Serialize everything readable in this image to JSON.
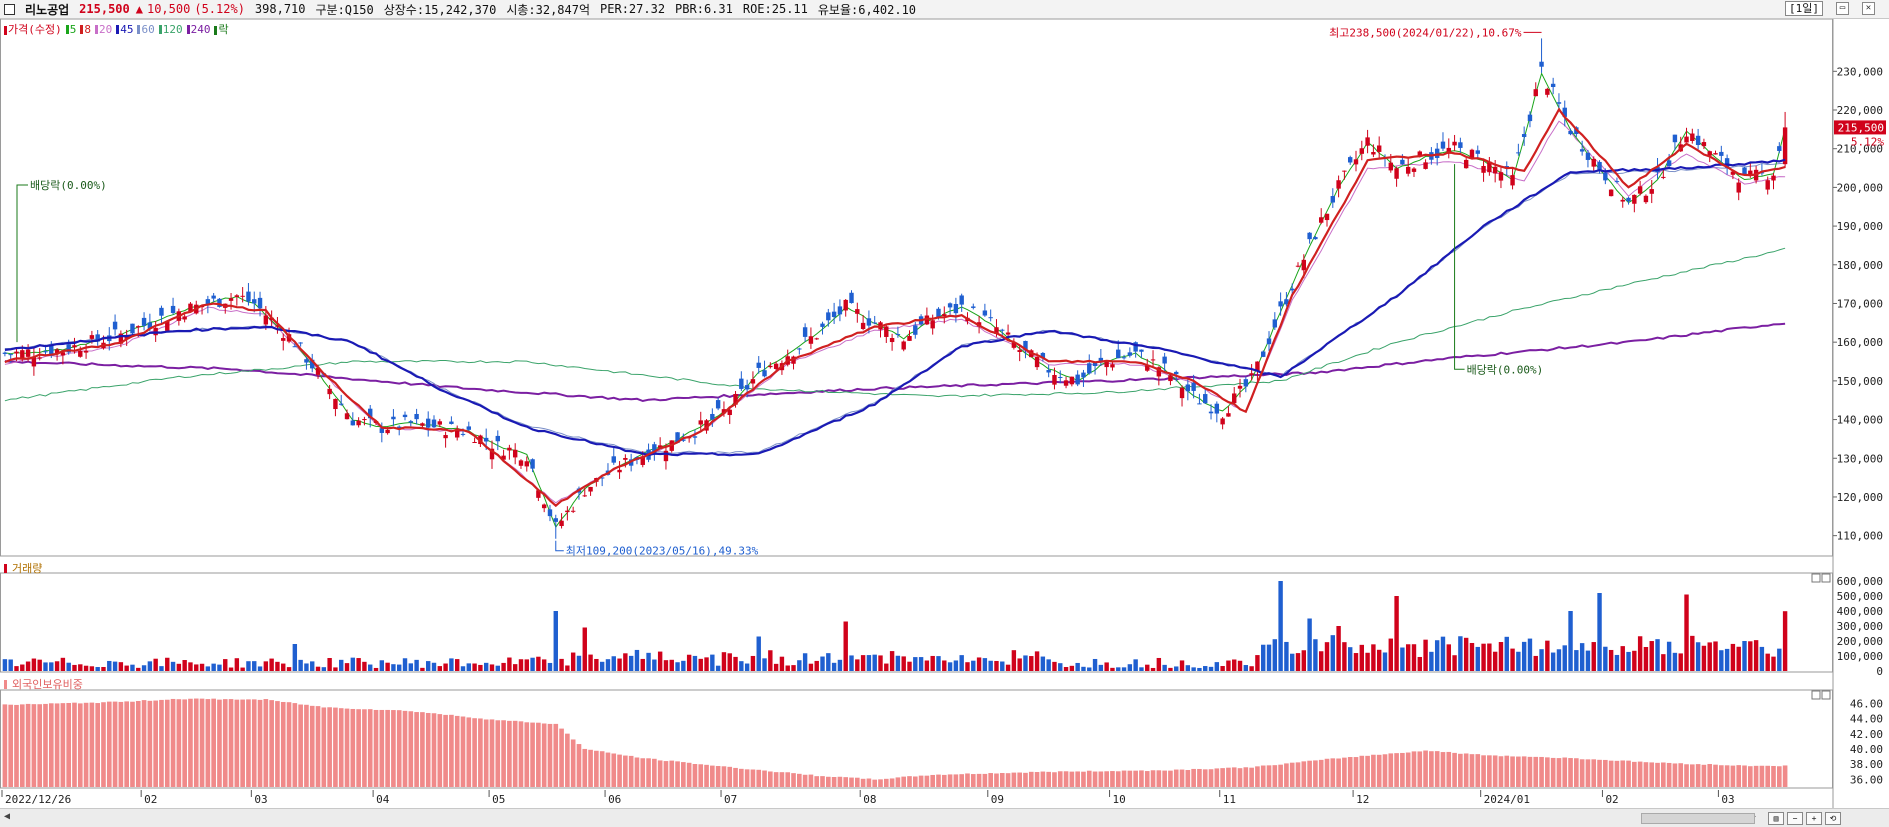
{
  "header": {
    "stock_name": "리노공업",
    "price": "215,500",
    "change_arrow": "▲",
    "change": "10,500",
    "change_pct": "(5.12%)",
    "volume": "398,710",
    "market": "구분:Q150",
    "shares": "상장수:15,242,370",
    "market_cap": "시총:32,847억",
    "per": "PER:27.32",
    "pbr": "PBR:6.31",
    "roe": "ROE:25.11",
    "float": "유보율:6,402.10",
    "period": "[1일]"
  },
  "legend_price": {
    "title": "가격(수정)",
    "items": [
      {
        "label": "5",
        "color": "#1aa51a"
      },
      {
        "label": "8",
        "color": "#d02020"
      },
      {
        "label": "20",
        "color": "#c86fc8"
      },
      {
        "label": "45",
        "color": "#1a1ab4"
      },
      {
        "label": "60",
        "color": "#7a8fc8"
      },
      {
        "label": "120",
        "color": "#3aa36a"
      },
      {
        "label": "240",
        "color": "#7b1fa2"
      },
      {
        "label": "락",
        "color": "#1a7a1a"
      }
    ]
  },
  "legend_volume": {
    "title": "거래량"
  },
  "legend_foreign": {
    "title": "외국인보유비중"
  },
  "annotations": {
    "high": "최고238,500(2024/01/22),10.67%",
    "low": "최저109,200(2023/05/16),49.33%",
    "div1": "배당락(0.00%)",
    "div2": "배당락(0.00%)",
    "current_price": "215,500",
    "current_pct": "5.12%"
  },
  "colors": {
    "up": "#d0021b",
    "down": "#1f5fd0",
    "foreign_bar": "#f08a8a"
  },
  "chart_data": [
    {
      "type": "candlestick",
      "title": "가격(수정)",
      "x_ticks": [
        "2022/12/26",
        "02",
        "03",
        "04",
        "05",
        "06",
        "07",
        "08",
        "09",
        "10",
        "11",
        "12",
        "2024/01",
        "02",
        "03"
      ],
      "y_ticks": [
        110000,
        120000,
        130000,
        140000,
        150000,
        160000,
        170000,
        180000,
        190000,
        200000,
        210000,
        220000,
        230000
      ],
      "ylim": [
        105000,
        243000
      ],
      "close_anchors": [
        [
          0,
          157000
        ],
        [
          10,
          158000
        ],
        [
          20,
          162000
        ],
        [
          30,
          168000
        ],
        [
          40,
          172000
        ],
        [
          43,
          170000
        ],
        [
          50,
          160000
        ],
        [
          55,
          150000
        ],
        [
          60,
          140000
        ],
        [
          65,
          138000
        ],
        [
          70,
          139000
        ],
        [
          75,
          138000
        ],
        [
          80,
          137000
        ],
        [
          85,
          133000
        ],
        [
          90,
          131000
        ],
        [
          95,
          112000
        ],
        [
          100,
          122000
        ],
        [
          105,
          127000
        ],
        [
          110,
          131000
        ],
        [
          115,
          134000
        ],
        [
          120,
          138000
        ],
        [
          125,
          143000
        ],
        [
          130,
          152000
        ],
        [
          135,
          157000
        ],
        [
          140,
          162000
        ],
        [
          145,
          169000
        ],
        [
          150,
          165000
        ],
        [
          155,
          161000
        ],
        [
          160,
          166000
        ],
        [
          165,
          169000
        ],
        [
          170,
          165000
        ],
        [
          175,
          158000
        ],
        [
          180,
          153000
        ],
        [
          185,
          150000
        ],
        [
          190,
          155000
        ],
        [
          195,
          157000
        ],
        [
          200,
          153000
        ],
        [
          205,
          146000
        ],
        [
          210,
          142000
        ],
        [
          215,
          150000
        ],
        [
          220,
          168000
        ],
        [
          225,
          185000
        ],
        [
          230,
          200000
        ],
        [
          235,
          212000
        ],
        [
          240,
          205000
        ],
        [
          245,
          208000
        ],
        [
          250,
          210000
        ],
        [
          255,
          207000
        ],
        [
          260,
          202000
        ],
        [
          265,
          230000
        ],
        [
          270,
          215000
        ],
        [
          275,
          205000
        ],
        [
          280,
          196000
        ],
        [
          285,
          202000
        ],
        [
          290,
          215000
        ],
        [
          295,
          208000
        ],
        [
          300,
          202000
        ],
        [
          305,
          204000
        ],
        [
          307,
          215500
        ]
      ],
      "ma8_anchors": [
        [
          0,
          155000
        ],
        [
          20,
          160000
        ],
        [
          35,
          170000
        ],
        [
          45,
          168000
        ],
        [
          55,
          152000
        ],
        [
          65,
          138000
        ],
        [
          80,
          137000
        ],
        [
          95,
          118000
        ],
        [
          105,
          127000
        ],
        [
          120,
          137000
        ],
        [
          135,
          155000
        ],
        [
          150,
          164000
        ],
        [
          165,
          167000
        ],
        [
          180,
          155000
        ],
        [
          195,
          155000
        ],
        [
          205,
          150000
        ],
        [
          214,
          142000
        ],
        [
          222,
          172000
        ],
        [
          235,
          207000
        ],
        [
          250,
          209000
        ],
        [
          262,
          204000
        ],
        [
          268,
          220000
        ],
        [
          280,
          200000
        ],
        [
          290,
          211000
        ],
        [
          300,
          203000
        ],
        [
          307,
          205000
        ]
      ],
      "ma45_anchors": [
        [
          0,
          158000
        ],
        [
          30,
          163000
        ],
        [
          45,
          164000
        ],
        [
          60,
          160000
        ],
        [
          75,
          148000
        ],
        [
          90,
          138000
        ],
        [
          110,
          131000
        ],
        [
          130,
          131000
        ],
        [
          150,
          144000
        ],
        [
          165,
          159000
        ],
        [
          180,
          163000
        ],
        [
          200,
          158000
        ],
        [
          220,
          151000
        ],
        [
          240,
          172000
        ],
        [
          255,
          190000
        ],
        [
          270,
          204000
        ],
        [
          290,
          205000
        ],
        [
          307,
          207000
        ]
      ],
      "ma120_anchors": [
        [
          0,
          145000
        ],
        [
          30,
          151000
        ],
        [
          60,
          155000
        ],
        [
          90,
          155000
        ],
        [
          130,
          148000
        ],
        [
          160,
          146000
        ],
        [
          190,
          147000
        ],
        [
          220,
          150000
        ],
        [
          240,
          160000
        ],
        [
          260,
          168000
        ],
        [
          280,
          175000
        ],
        [
          307,
          184000
        ]
      ],
      "ma240_anchors": [
        [
          0,
          155000
        ],
        [
          40,
          153000
        ],
        [
          80,
          148000
        ],
        [
          110,
          145000
        ],
        [
          150,
          148000
        ],
        [
          190,
          150000
        ],
        [
          225,
          152000
        ],
        [
          250,
          156000
        ],
        [
          280,
          160000
        ],
        [
          307,
          165000
        ]
      ],
      "high": {
        "price": 238500,
        "date": "2024/01/22",
        "pct": "10.67%"
      },
      "low": {
        "price": 109200,
        "date": "2023/05/16",
        "pct": "49.33%"
      }
    },
    {
      "type": "bar",
      "title": "거래량",
      "y_ticks": [
        0,
        100000,
        200000,
        300000,
        400000,
        500000,
        600000
      ],
      "ylim": [
        0,
        640000
      ],
      "spikes": [
        [
          50,
          180000
        ],
        [
          95,
          400000
        ],
        [
          100,
          290000
        ],
        [
          130,
          230000
        ],
        [
          145,
          330000
        ],
        [
          220,
          600000
        ],
        [
          225,
          350000
        ],
        [
          230,
          300000
        ],
        [
          240,
          500000
        ],
        [
          270,
          400000
        ],
        [
          275,
          520000
        ],
        [
          290,
          510000
        ],
        [
          300,
          200000
        ],
        [
          307,
          398710
        ]
      ]
    },
    {
      "type": "bar",
      "title": "외국인보유비중",
      "y_ticks": [
        36.0,
        38.0,
        40.0,
        42.0,
        44.0,
        46.0
      ],
      "ylim": [
        35,
        47.5
      ],
      "value_anchors": [
        [
          0,
          45.8
        ],
        [
          20,
          46.2
        ],
        [
          30,
          46.6
        ],
        [
          45,
          46.5
        ],
        [
          55,
          45.5
        ],
        [
          70,
          45.0
        ],
        [
          85,
          43.8
        ],
        [
          95,
          43.3
        ],
        [
          100,
          40.0
        ],
        [
          110,
          38.8
        ],
        [
          125,
          37.6
        ],
        [
          140,
          36.5
        ],
        [
          150,
          36.0
        ],
        [
          160,
          36.6
        ],
        [
          180,
          37.0
        ],
        [
          200,
          37.2
        ],
        [
          215,
          37.6
        ],
        [
          230,
          38.8
        ],
        [
          245,
          39.8
        ],
        [
          255,
          39.2
        ],
        [
          270,
          38.8
        ],
        [
          285,
          38.2
        ],
        [
          300,
          37.8
        ],
        [
          307,
          37.8
        ]
      ]
    }
  ]
}
